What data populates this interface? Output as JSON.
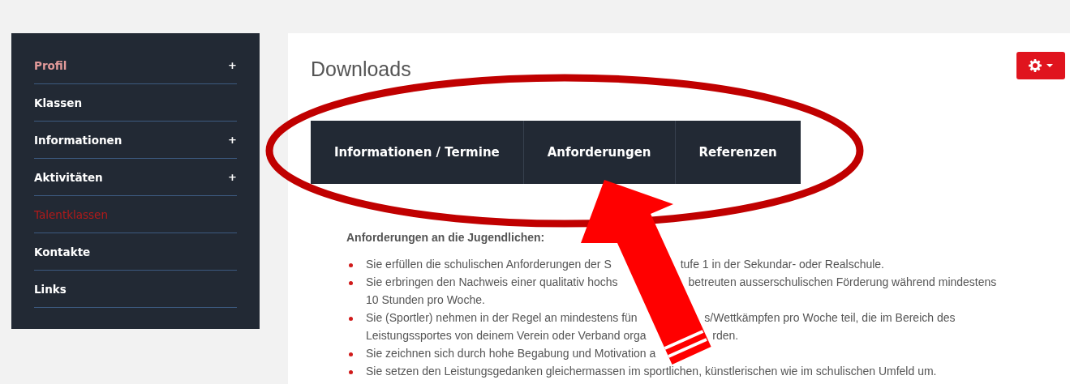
{
  "sidebar": {
    "items": [
      {
        "label": "Profil",
        "visited": true,
        "selected": false,
        "toggle": "+"
      },
      {
        "label": "Klassen",
        "visited": false,
        "selected": false
      },
      {
        "label": "Informationen",
        "visited": false,
        "selected": false,
        "toggle": "+"
      },
      {
        "label": "Aktivitäten",
        "visited": false,
        "selected": false,
        "toggle": "+"
      },
      {
        "label": "Talentklassen",
        "visited": false,
        "selected": true
      },
      {
        "label": "Kontakte",
        "visited": false,
        "selected": false
      },
      {
        "label": "Links",
        "visited": false,
        "selected": false
      }
    ]
  },
  "page": {
    "title": "Downloads"
  },
  "tabs": [
    {
      "label": "Informationen / Termine"
    },
    {
      "label": "Anforderungen"
    },
    {
      "label": "Referenzen"
    }
  ],
  "content": {
    "heading": "Anforderungen an die Jugendlichen:",
    "bullets": [
      {
        "lines": [
          [
            "Sie erfüllen die schulischen Anforderungen der S",
            "tufe 1 in der Sekundar- oder Realschule."
          ]
        ]
      },
      {
        "lines": [
          [
            "Sie erbringen den Nachweis einer qualitativ hochs",
            "betreuten ausserschulischen Förderung während mindestens"
          ],
          [
            "10 Stunden pro Woche."
          ]
        ]
      },
      {
        "lines": [
          [
            "Sie (Sportler) nehmen in der Regel an mindestens fün",
            "s/Wettkämpfen pro Woche teil, die im Bereich des"
          ],
          [
            "Leistungssportes von deinem Verein oder Verband orga",
            "rden."
          ]
        ]
      },
      {
        "lines": [
          [
            "Sie zeichnen sich durch hohe Begabung und Motivation a"
          ]
        ]
      },
      {
        "lines": [
          [
            "Sie setzen den Leistungsgedanken gleichermassen im sportlichen, künstlerischen wie im schulischen Umfeld um."
          ]
        ]
      }
    ]
  }
}
